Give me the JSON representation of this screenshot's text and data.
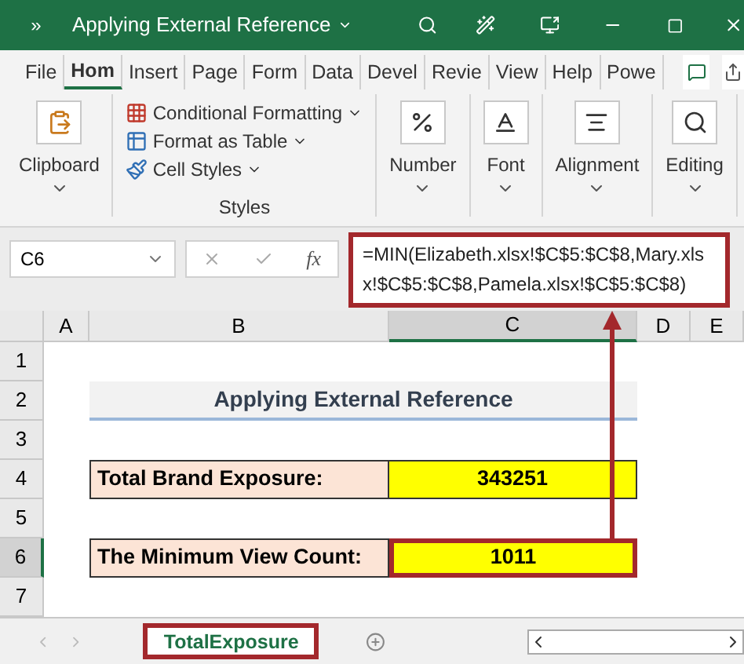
{
  "title_bar": {
    "quick_access": "»",
    "title": "Applying External Reference"
  },
  "menu_tabs": [
    {
      "label": "File",
      "selected": false
    },
    {
      "label": "Hom",
      "selected": true
    },
    {
      "label": "Insert",
      "selected": false
    },
    {
      "label": "Page",
      "selected": false
    },
    {
      "label": "Form",
      "selected": false
    },
    {
      "label": "Data",
      "selected": false
    },
    {
      "label": "Devel",
      "selected": false
    },
    {
      "label": "Revie",
      "selected": false
    },
    {
      "label": "View",
      "selected": false
    },
    {
      "label": "Help",
      "selected": false
    },
    {
      "label": "Powe",
      "selected": false
    }
  ],
  "ribbon": {
    "groups": [
      {
        "kind": "large",
        "label": "Clipboard"
      },
      {
        "kind": "list",
        "label": "Styles",
        "items": [
          {
            "label": "Conditional Formatting"
          },
          {
            "label": "Format as Table"
          },
          {
            "label": "Cell Styles"
          }
        ]
      },
      {
        "kind": "large",
        "label": "Number"
      },
      {
        "kind": "large",
        "label": "Font"
      },
      {
        "kind": "large",
        "label": "Alignment"
      },
      {
        "kind": "large",
        "label": "Editing"
      }
    ]
  },
  "formula_bar": {
    "name_box": "C6",
    "function_label": "fx",
    "formula": "=MIN(Elizabeth.xlsx!$C$5:$C$8,Mary.xlsx!$C$5:$C$8,Pamela.xlsx!$C$5:$C$8)"
  },
  "columns": [
    {
      "label": "A",
      "selected": false
    },
    {
      "label": "B",
      "selected": false
    },
    {
      "label": "C",
      "selected": true
    },
    {
      "label": "D",
      "selected": false
    },
    {
      "label": "E",
      "selected": false
    }
  ],
  "rows": [
    {
      "label": "1",
      "selected": false
    },
    {
      "label": "2",
      "selected": false
    },
    {
      "label": "3",
      "selected": false
    },
    {
      "label": "4",
      "selected": false
    },
    {
      "label": "5",
      "selected": false
    },
    {
      "label": "6",
      "selected": true
    },
    {
      "label": "7",
      "selected": false
    }
  ],
  "sheet_title": "Applying External Reference",
  "summary": [
    {
      "label": "Total Brand Exposure:",
      "value": "343251",
      "highlighted": false
    },
    {
      "label": "The Minimum View Count:",
      "value": "1011",
      "highlighted": true
    }
  ],
  "sheet_tabs": [
    {
      "label": "TotalExposure",
      "selected": true
    }
  ]
}
